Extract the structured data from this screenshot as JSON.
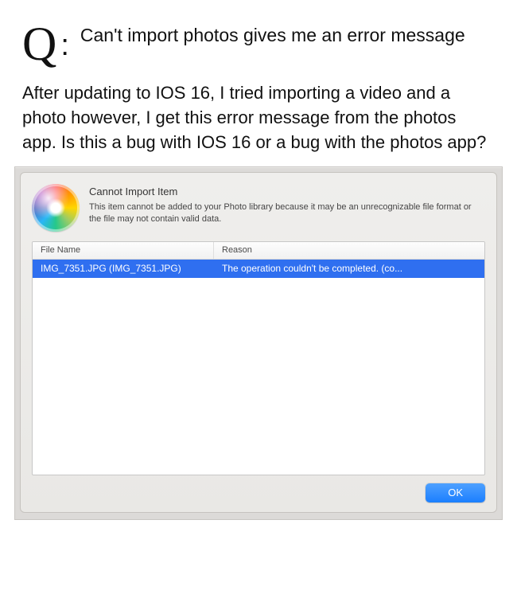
{
  "question": {
    "prefix": "Q",
    "colon": ":",
    "title": "Can't import photos gives me an error message",
    "body": "After updating to IOS 16, I tried importing a video and a photo however, I get this error message from the photos app. Is this a bug with IOS 16 or a bug with the photos app?"
  },
  "dialog": {
    "title": "Cannot Import Item",
    "description": "This item cannot be added to your Photo library because it may be an unrecognizable file format or the file may not contain valid data.",
    "columns": {
      "file": "File Name",
      "reason": "Reason"
    },
    "rows": [
      {
        "file": "IMG_7351.JPG (IMG_7351.JPG)",
        "reason": "The operation couldn't be completed. (co..."
      }
    ],
    "ok": "OK"
  }
}
